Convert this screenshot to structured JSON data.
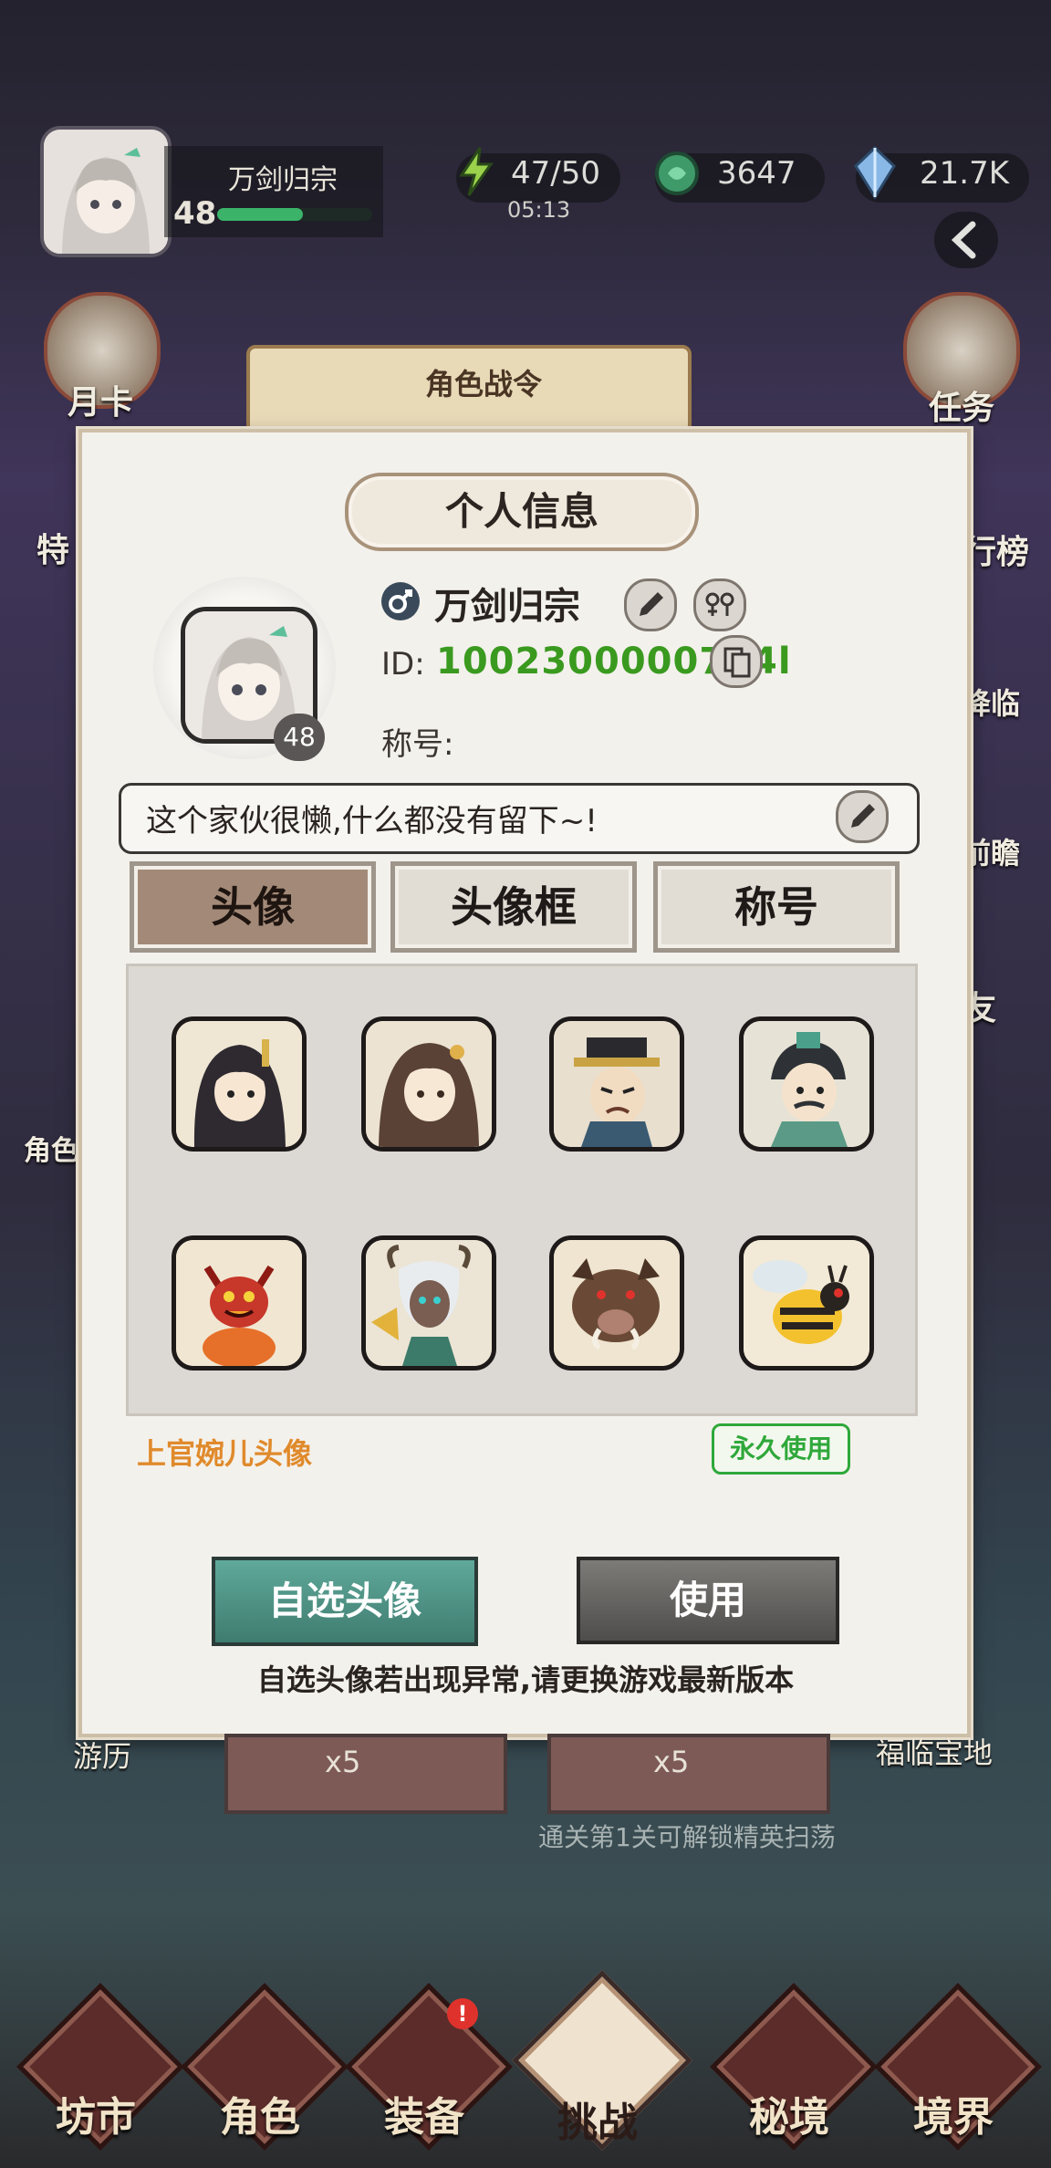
{
  "top_bar": {
    "player_name": "万剑归宗",
    "level": "48",
    "xp_fraction": 0.55,
    "stamina": "47/50",
    "stamina_timer": "05:13",
    "jade": "3647",
    "crystal": "21.7K"
  },
  "background": {
    "left_labels": [
      "月卡",
      "特",
      "角色"
    ],
    "right_labels": [
      "任务",
      "行榜",
      "降临",
      "前瞻",
      "友"
    ],
    "banner_title": "角色战令",
    "bottom_left_label": "游历",
    "bottom_right_label": "福临宝地",
    "sweep_cost": "x5",
    "unlock_text": "通关第1关可解锁精英扫荡"
  },
  "dialog": {
    "title": "个人信息",
    "player": {
      "name": "万剑归宗",
      "id_label": "ID:",
      "id_value": "1002300000794l",
      "level": "48",
      "title_label": "称号:",
      "signature": "这个家伙很懒,什么都没有留下~!"
    },
    "tabs": [
      {
        "label": "头像",
        "active": true
      },
      {
        "label": "头像框",
        "active": false
      },
      {
        "label": "称号",
        "active": false
      }
    ],
    "avatars": [
      {
        "icon": "dark-haired-swordsman-portrait"
      },
      {
        "icon": "long-haired-lady-portrait"
      },
      {
        "icon": "official-hat-man-portrait"
      },
      {
        "icon": "mustached-scholar-portrait"
      },
      {
        "icon": "red-demon-portrait"
      },
      {
        "icon": "horned-warrior-portrait"
      },
      {
        "icon": "wild-boar-portrait"
      },
      {
        "icon": "giant-bee-portrait"
      }
    ],
    "selected_name": "上官婉儿头像",
    "permanent_badge": "永久使用",
    "custom_avatar_button": "自选头像",
    "use_button": "使用",
    "hint": "自选头像若出现异常,请更换游戏最新版本"
  },
  "bottom_nav": [
    {
      "label": "坊市",
      "active": false
    },
    {
      "label": "角色",
      "active": false
    },
    {
      "label": "装备",
      "active": false,
      "badge": "!"
    },
    {
      "label": "挑战",
      "active": true
    },
    {
      "label": "秘境",
      "active": false
    },
    {
      "label": "境界",
      "active": false
    }
  ],
  "colors": {
    "id_green": "#3a9a1f",
    "selected_orange": "#e08a2c",
    "badge_green": "#2fa83a",
    "custom_button_teal": "#4f9184"
  }
}
